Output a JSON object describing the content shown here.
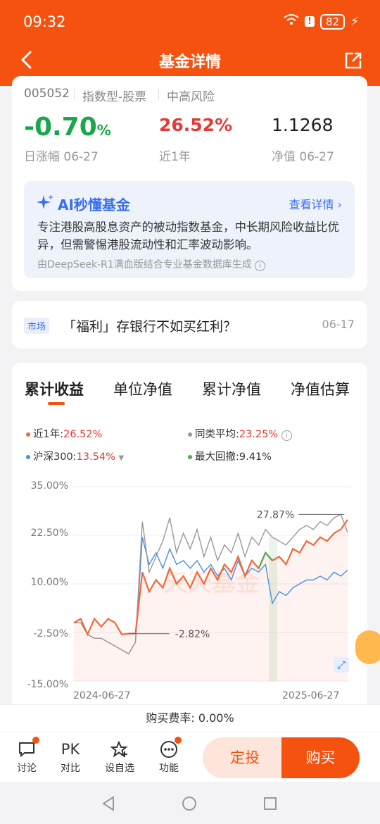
{
  "status": {
    "time": "09:32",
    "battery": "82"
  },
  "header": {
    "title": "基金详情"
  },
  "fund": {
    "code": "005052",
    "type": "指数型-股票",
    "risk": "中高风险",
    "daily_change": "-0.70",
    "daily_change_unit": "%",
    "daily_label": "日涨幅 06-27",
    "year_return": "26.52%",
    "year_label": "近1年",
    "nav": "1.1268",
    "nav_label": "净值 06-27"
  },
  "ai": {
    "title": "AI秒懂基金",
    "link": "查看详情",
    "text": "专注港股高股息资产的被动指数基金，中长期风险收益比优异，但需警惕港股流动性和汇率波动影响。",
    "source": "由DeepSeek-R1满血版结合专业基金数据库生成"
  },
  "news": {
    "tag": "市场",
    "text": "「福利」存银行不如买红利？",
    "date": "06-17"
  },
  "tabs": [
    "累计收益",
    "单位净值",
    "累计净值",
    "净值估算"
  ],
  "legend": {
    "fund": {
      "label": "近1年:",
      "value": "26.52%"
    },
    "peer": {
      "label": "同类平均:",
      "value": "23.25%"
    },
    "hs300": {
      "label": "沪深300:",
      "value": "13.54%"
    },
    "drawdown": {
      "label": "最大回撤:",
      "value": "9.41%"
    }
  },
  "colors": {
    "accent": "#f5520f",
    "fund": "#f0683a",
    "peer": "#999999",
    "hs300": "#4a90e2",
    "drawdown": "#4caf50",
    "up": "#e53935",
    "down": "#1aa64a"
  },
  "chart_data": {
    "type": "line",
    "x_labels": [
      "2024-06-27",
      "2025-06-27"
    ],
    "yticks": [
      "35.00%",
      "22.50%",
      "10.00%",
      "-2.50%",
      "-15.00%"
    ],
    "ylim": [
      -15,
      35
    ],
    "annotations": {
      "max": "27.87%",
      "min": "-2.82%"
    },
    "watermark": "天天基金",
    "series": [
      {
        "name": "近1年",
        "values": [
          0,
          1,
          -3,
          1,
          -1,
          1,
          0,
          -3,
          -2.8,
          -2.8,
          13,
          8,
          11,
          9,
          14,
          10,
          12,
          9,
          13,
          10,
          14,
          11,
          15,
          13,
          17,
          12,
          16,
          14,
          18,
          16,
          17,
          15,
          19,
          18,
          21,
          20,
          22,
          21,
          23,
          24,
          26.52
        ]
      },
      {
        "name": "同类平均",
        "values": [
          0,
          0,
          -3,
          -4,
          -4,
          -5,
          -6,
          -7,
          -8,
          -5,
          26,
          13,
          17,
          21,
          27,
          18,
          23,
          19,
          24,
          17,
          22,
          16,
          20,
          18,
          23,
          17,
          22,
          20,
          24,
          22,
          21,
          20,
          22,
          24,
          25,
          24,
          26,
          25,
          27,
          27.87,
          23.25
        ]
      },
      {
        "name": "沪深300",
        "values": [
          0,
          0,
          -3,
          -4,
          -4,
          -5,
          -6,
          -7,
          -8,
          -5,
          22,
          15,
          18,
          14,
          19,
          15,
          16,
          14,
          16,
          13,
          15,
          12,
          14,
          11,
          16,
          12,
          14,
          13,
          15,
          5,
          8,
          7,
          9,
          10,
          11,
          11,
          12,
          11,
          13,
          12,
          13.54
        ]
      }
    ]
  },
  "fee": {
    "text": "购买费率: 0.00%"
  },
  "bottom": {
    "discuss": "讨论",
    "compare_icon": "PK",
    "compare": "对比",
    "watch": "设自选",
    "func": "功能",
    "fixed": "定投",
    "buy": "购买"
  }
}
